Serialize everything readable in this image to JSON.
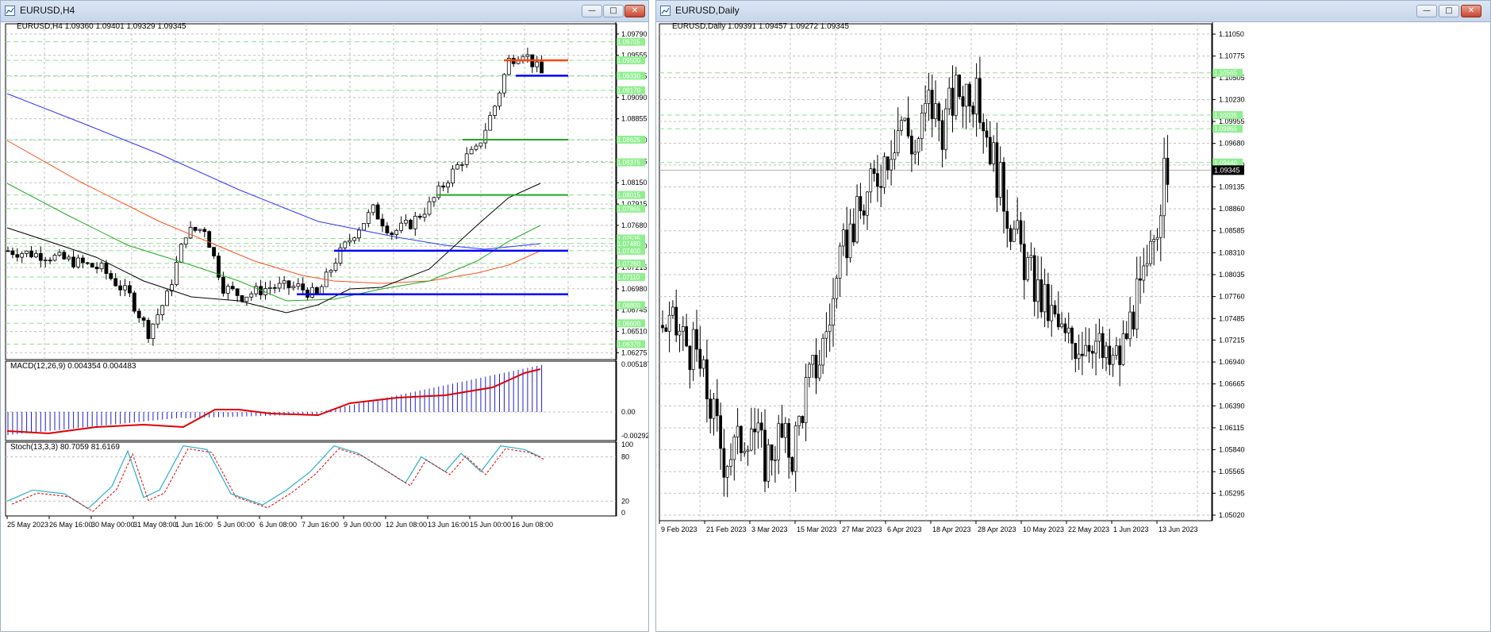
{
  "left": {
    "title": "EURUSD,H4",
    "info": "EURUSD,H4  1.09360 1.09401 1.09329 1.09345",
    "price_axis": [
      "1.09790",
      "1.09555",
      "1.09325",
      "1.09090",
      "1.08855",
      "1.08620",
      "1.08385",
      "1.08150",
      "1.07915",
      "1.07680",
      "1.07450",
      "1.07215",
      "1.06980",
      "1.06745",
      "1.06510",
      "1.06275"
    ],
    "level_tags": [
      "1.09705",
      "1.09500",
      "1.09330",
      "1.09170",
      "1.08625",
      "1.08375",
      "1.08015",
      "1.07865",
      "1.07535",
      "1.07480",
      "1.07400",
      "1.07260",
      "1.07110",
      "1.06800",
      "1.06600",
      "1.06370"
    ],
    "time_axis": [
      "25 May 2023",
      "26 May 16:00",
      "30 May 00:00",
      "31 May 08:00",
      "1 Jun 16:00",
      "5 Jun 00:00",
      "6 Jun 08:00",
      "7 Jun 16:00",
      "9 Jun 00:00",
      "12 Jun 08:00",
      "13 Jun 16:00",
      "15 Jun 00:00",
      "16 Jun 08:00"
    ],
    "macd_label": "MACD(12,26,9) 0.004354 0.004483",
    "macd_axis": [
      "0.005187",
      "0.00",
      "-0.002921"
    ],
    "stoch_label": "Stoch(13,3,3) 80.7059 81.6169",
    "stoch_axis": [
      "100",
      "80",
      "20",
      "0"
    ]
  },
  "right": {
    "title": "EURUSD,Daily",
    "info": "EURUSD,Daily  1.09391 1.09457 1.09272 1.09345",
    "price_axis": [
      "1.11050",
      "1.10775",
      "1.10505",
      "1.10230",
      "1.09955",
      "1.09680",
      "1.09410",
      "1.09135",
      "1.08860",
      "1.08585",
      "1.08310",
      "1.08035",
      "1.07760",
      "1.07485",
      "1.07215",
      "1.06940",
      "1.06665",
      "1.06390",
      "1.06115",
      "1.05840",
      "1.05565",
      "1.05295",
      "1.05020"
    ],
    "level_tags": [
      "1.10565",
      "1.10035",
      "1.09865",
      "1.09440"
    ],
    "current_price": "1.09345",
    "time_axis": [
      "9 Feb 2023",
      "21 Feb 2023",
      "3 Mar 2023",
      "15 Mar 2023",
      "27 Mar 2023",
      "6 Apr 2023",
      "18 Apr 2023",
      "28 Apr 2023",
      "10 May 2023",
      "22 May 2023",
      "1 Jun 2023",
      "13 Jun 2023"
    ]
  },
  "colors": {
    "level_green": "#8fe08f",
    "tag_green": "#90ee90",
    "support_blue": "#0000ff",
    "resistance_red": "#ff4500",
    "ma_blue": "#3333ff",
    "ma_red": "#ff5020",
    "ma_green": "#22aa22",
    "ma_black": "#000000"
  },
  "icons": [
    "chart-window-icon",
    "minimize-icon",
    "restore-icon",
    "close-icon"
  ]
}
